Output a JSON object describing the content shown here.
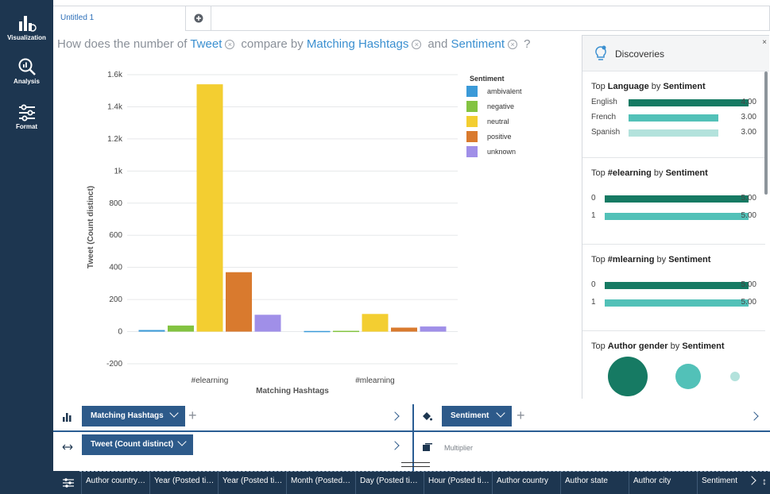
{
  "sidebar": {
    "items": [
      {
        "label": "Visualization",
        "icon": "bar-chart-icon"
      },
      {
        "label": "Analysis",
        "icon": "magnifier-chart-icon"
      },
      {
        "label": "Format",
        "icon": "sliders-icon"
      }
    ]
  },
  "tabs": [
    {
      "label": "Untitled 1"
    }
  ],
  "question": {
    "prefix": "How does the number of",
    "measure": "Tweet",
    "mid": "compare by",
    "dim1": "Matching Hashtags",
    "and": "and",
    "dim2": "Sentiment",
    "suffix": "?"
  },
  "chart_data": {
    "type": "bar",
    "categories": [
      "#elearning",
      "#mlearning"
    ],
    "xlabel": "Matching Hashtags",
    "ylabel": "Tweet (Count distinct)",
    "ylim": [
      -200,
      1600
    ],
    "yticks": [
      "1.6k",
      "1.4k",
      "1.2k",
      "1k",
      "800",
      "600",
      "400",
      "200",
      "0",
      "-200"
    ],
    "ytick_values": [
      1600,
      1400,
      1200,
      1000,
      800,
      600,
      400,
      200,
      0,
      -200
    ],
    "legend_title": "Sentiment",
    "legend_position": "right",
    "series": [
      {
        "name": "ambivalent",
        "color": "#3b9ad8",
        "values": [
          10,
          4
        ]
      },
      {
        "name": "negative",
        "color": "#83c341",
        "values": [
          38,
          5
        ]
      },
      {
        "name": "neutral",
        "color": "#f3ce31",
        "values": [
          1540,
          110
        ]
      },
      {
        "name": "positive",
        "color": "#d97a2e",
        "values": [
          370,
          25
        ]
      },
      {
        "name": "unknown",
        "color": "#a08fe8",
        "values": [
          105,
          32
        ]
      }
    ]
  },
  "discoveries": {
    "title": "Discoveries",
    "close": "×",
    "cards": [
      {
        "pre": "Top",
        "field": "Language",
        "mid": "by",
        "by": "Sentiment",
        "rows": [
          {
            "label": "English",
            "value": "4.00",
            "frac": 1.0,
            "color": "#167a63"
          },
          {
            "label": "French",
            "value": "3.00",
            "frac": 0.75,
            "color": "#52c1b8"
          },
          {
            "label": "Spanish",
            "value": "3.00",
            "frac": 0.75,
            "color": "#b3e2dc"
          }
        ]
      },
      {
        "pre": "Top",
        "field": "#elearning",
        "mid": "by",
        "by": "Sentiment",
        "rows": [
          {
            "label": "0",
            "value": "5.00",
            "frac": 1.0,
            "color": "#167a63"
          },
          {
            "label": "1",
            "value": "5.00",
            "frac": 1.0,
            "color": "#52c1b8"
          }
        ]
      },
      {
        "pre": "Top",
        "field": "#mlearning",
        "mid": "by",
        "by": "Sentiment",
        "rows": [
          {
            "label": "0",
            "value": "5.00",
            "frac": 1.0,
            "color": "#167a63"
          },
          {
            "label": "1",
            "value": "5.00",
            "frac": 1.0,
            "color": "#52c1b8"
          }
        ]
      },
      {
        "pre": "Top",
        "field": "Author gender",
        "mid": "by",
        "by": "Sentiment",
        "bubbles": [
          {
            "color": "#167a63"
          },
          {
            "color": "#52c1b8"
          },
          {
            "color": "#b3e2dc"
          }
        ]
      }
    ]
  },
  "shelves": {
    "x_axis": {
      "chip": "Matching Hashtags",
      "icon": "bar-axis-icon"
    },
    "color": {
      "chip": "Sentiment",
      "icon": "paint-bucket-icon"
    },
    "y_axis": {
      "chip": "Tweet (Count distinct)",
      "icon": "horizontal-arrows-icon"
    },
    "multiplier": {
      "label": "Multiplier",
      "icon": "multiplier-icon"
    }
  },
  "fields_bar": [
    "Author country…",
    "Year (Posted ti…",
    "Year (Posted ti…",
    "Month (Posted…",
    "Day (Posted ti…",
    "Hour (Posted ti…",
    "Author country",
    "Author state",
    "Author city",
    "Sentiment"
  ]
}
